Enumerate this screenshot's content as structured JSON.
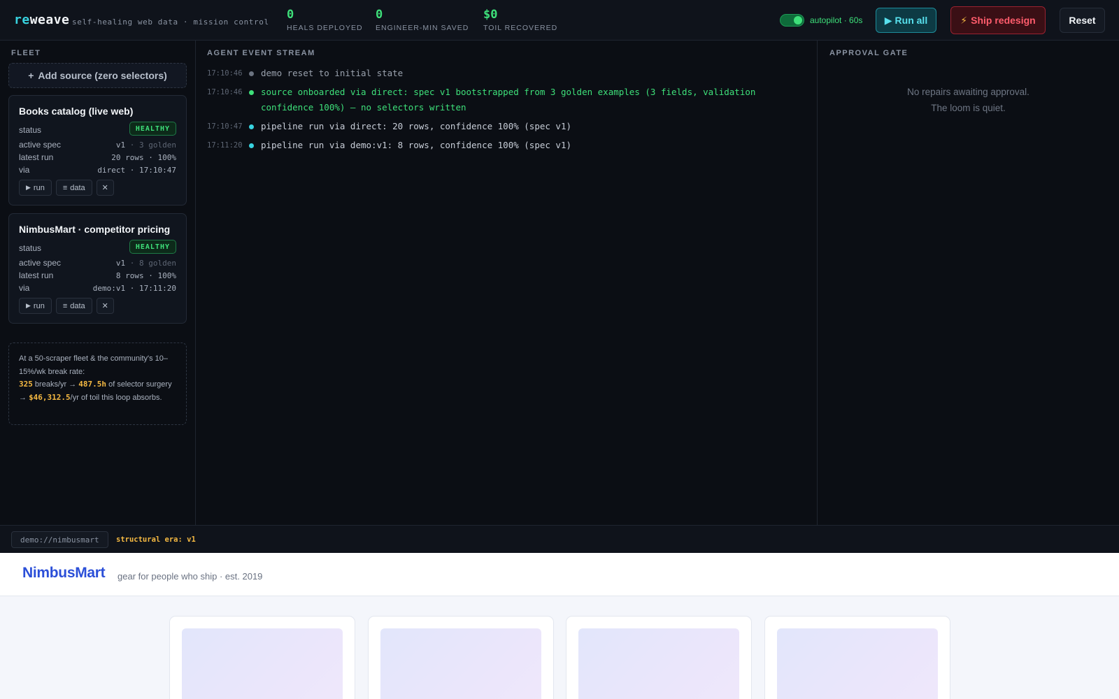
{
  "app": {
    "brand_prefix": "re",
    "brand_suffix": "weave",
    "tagline": "self-healing web data · mission control"
  },
  "kpis": [
    {
      "value": "0",
      "label": "HEALS DEPLOYED"
    },
    {
      "value": "0",
      "label": "ENGINEER-MIN SAVED"
    },
    {
      "value": "$0",
      "label": "TOIL RECOVERED"
    }
  ],
  "header": {
    "autopilot_label": "autopilot · 60s",
    "autopilot_on": true,
    "run_all_label": "Run all",
    "ship_redesign_label": "Ship redesign",
    "reset_label": "Reset"
  },
  "fleet": {
    "title": "FLEET",
    "add_source_label": "Add source (zero selectors)",
    "field_labels": {
      "status": "status",
      "active_spec": "active spec",
      "latest_run": "latest run",
      "via": "via"
    },
    "action_labels": {
      "run": "run",
      "data": "data"
    },
    "sources": [
      {
        "name": "Books catalog (live web)",
        "status": "HEALTHY",
        "spec_version": "v1",
        "spec_golden": "· 3 golden",
        "latest_run": "20 rows · 100%",
        "via": "direct · 17:10:47"
      },
      {
        "name": "NimbusMart · competitor pricing",
        "status": "HEALTHY",
        "spec_version": "v1",
        "spec_golden": "· 8 golden",
        "latest_run": "8 rows · 100%",
        "via": "demo:v1 · 17:11:20"
      }
    ],
    "roi": {
      "intro": "At a 50-scraper fleet & the community's 10–15%/wk break rate:",
      "breaks": "325",
      "breaks_text": " breaks/yr → ",
      "hours": "487.5h",
      "hours_text": " of selector surgery → ",
      "dollars": "$46,312.5",
      "dollars_text": "/yr of toil this loop absorbs."
    }
  },
  "stream": {
    "title": "AGENT EVENT STREAM",
    "events": [
      {
        "time": "17:10:46",
        "kind": "muted",
        "message": "demo reset to initial state"
      },
      {
        "time": "17:10:46",
        "kind": "success",
        "message": "source onboarded via direct: spec v1 bootstrapped from 3 golden examples (3 fields, validation confidence 100%) — no selectors written"
      },
      {
        "time": "17:10:47",
        "kind": "info",
        "message": "pipeline run via direct: 20 rows, confidence 100% (spec v1)"
      },
      {
        "time": "17:11:20",
        "kind": "info",
        "message": "pipeline run via demo:v1: 8 rows, confidence 100% (spec v1)"
      }
    ]
  },
  "gate": {
    "title": "APPROVAL GATE",
    "empty_line1": "No repairs awaiting approval.",
    "empty_line2": "The loom is quiet."
  },
  "status_strip": {
    "url": "demo://nimbusmart",
    "era": "structural era: v1"
  },
  "demo_site": {
    "logo": "NimbusMart",
    "tagline": "gear for people who ship · est. 2019",
    "product_count": 4
  },
  "colors": {
    "accent_cyan": "#38d3e0",
    "success_green": "#3ee07a",
    "danger_red": "#ff5c6c",
    "warning_amber": "#f5b942",
    "site_brand_blue": "#2b4fd8"
  }
}
